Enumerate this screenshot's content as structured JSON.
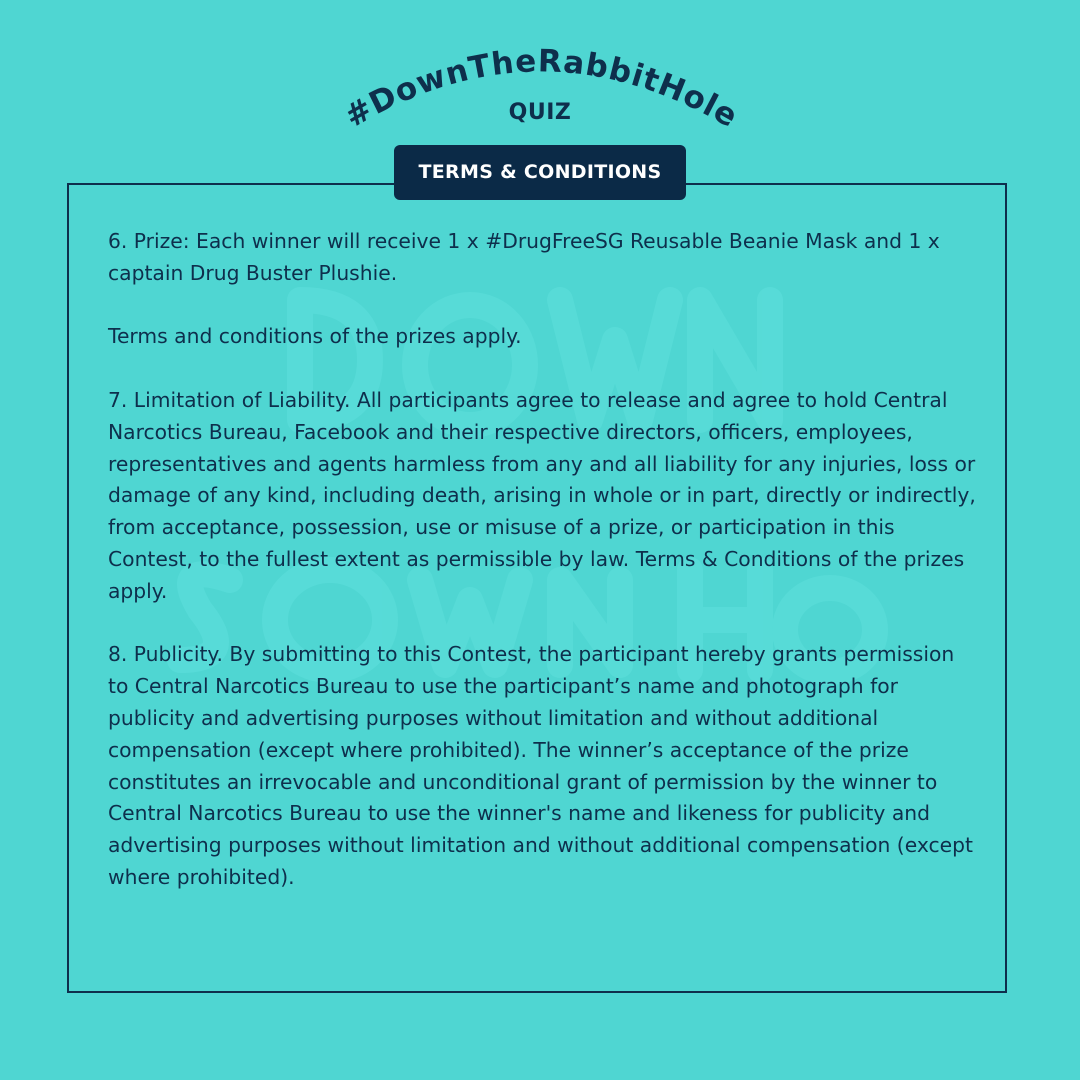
{
  "header": {
    "hashtag": "#DownTheRabbitHole",
    "subtitle": "QUIZ",
    "tab_label": "TERMS & CONDITIONS"
  },
  "paragraphs": [
    "6. Prize: Each winner will receive 1 x #DrugFreeSG Reusable Beanie Mask and 1 x captain Drug Buster Plushie.",
    "Terms and conditions of the prizes apply.",
    "7. Limitation of Liability. All participants agree to release and agree to hold Central Narcotics Bureau, Facebook and their respective directors, officers, employees, representatives and agents harmless from any and all liability for any injuries, loss or damage of any kind, including death, arising in whole or in part, directly or indirectly, from acceptance, possession, use or misuse of a prize, or participation in this Contest, to the fullest extent as permissible by law. Terms & Conditions of the prizes apply.",
    "8. Publicity. By submitting to this Contest, the participant hereby grants permission to Central Narcotics Bureau to use the participant’s name and photograph for publicity and advertising purposes without limitation and without additional compensation (except where prohibited). The winner’s acceptance of the prize constitutes an irrevocable and unconditional grant of permission by the winner to Central Narcotics Bureau to use the winner's name and likeness for publicity and advertising purposes without limitation and without additional compensation (except where prohibited)."
  ],
  "colors": {
    "background": "#4fd6d2",
    "text": "#0e2f4c",
    "tab_background": "#0b2a47",
    "tab_text": "#ffffff"
  }
}
